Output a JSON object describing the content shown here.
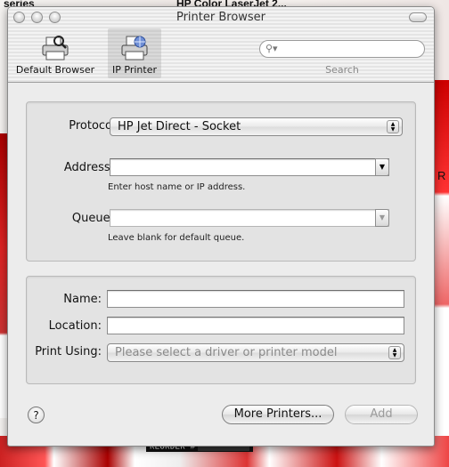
{
  "background": {
    "top_left_text": "series",
    "top_right_text": "HP Color LaserJet 2...",
    "side_letter": "R",
    "reorder_label": "REORDER #"
  },
  "window": {
    "title": "Printer Browser"
  },
  "toolbar": {
    "default_label": "Default Browser",
    "ip_label": "IP Printer",
    "search_placeholder": "",
    "search_label": "Search"
  },
  "connection": {
    "protocol_label": "Protocol:",
    "protocol_value": "HP Jet Direct - Socket",
    "address_label": "Address:",
    "address_value": "",
    "address_hint": "Enter host name or IP address.",
    "queue_label": "Queue:",
    "queue_value": "",
    "queue_hint": "Leave blank for default queue."
  },
  "details": {
    "name_label": "Name:",
    "name_value": "",
    "location_label": "Location:",
    "location_value": "",
    "print_using_label": "Print Using:",
    "print_using_value": "Please select a driver or printer model"
  },
  "footer": {
    "help_label": "?",
    "more_printers_label": "More Printers...",
    "add_label": "Add"
  }
}
